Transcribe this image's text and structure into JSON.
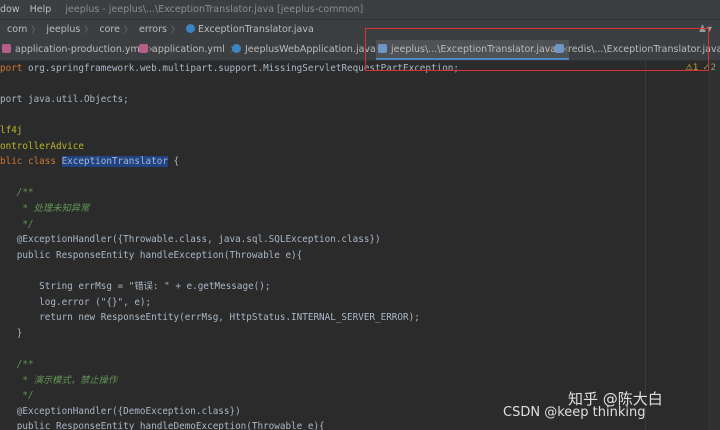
{
  "window": {
    "menu": [
      "dow",
      "Help"
    ],
    "title": "jeeplus - jeeplus\\...\\ExceptionTranslator.java [jeeplus-common]"
  },
  "breadcrumb": [
    "com",
    "jeeplus",
    "core",
    "errors",
    "ExceptionTranslator.java"
  ],
  "tabs": [
    {
      "label": "application-production.yml",
      "icon": "yml-file-icon"
    },
    {
      "label": "application.yml",
      "icon": "yml-file-icon"
    },
    {
      "label": "JeeplusWebApplication.java",
      "icon": "java-class-icon"
    },
    {
      "label": "jeeplus\\...\\ExceptionTranslator.java",
      "icon": "java-folder-icon"
    },
    {
      "label": "redis\\...\\ExceptionTranslator.java",
      "icon": "java-folder-icon"
    }
  ],
  "inspection": {
    "warnings": "1",
    "ok_count": "2"
  },
  "code": [
    "port org.springframework.web.multipart.support.MissingServletRequestPartException;",
    "",
    "port java.util.Objects;",
    "",
    "lf4j",
    "ontrollerAdvice",
    "blic class ExceptionTranslator {",
    "",
    "   /**",
    "    * 处理未知异常",
    "    */",
    "   @ExceptionHandler({Throwable.class, java.sql.SQLException.class})",
    "   public ResponseEntity handleException(Throwable e){",
    "",
    "       String errMsg = \"错误: \" + e.getMessage();",
    "       log.error (\"{}\", e);",
    "       return new ResponseEntity(errMsg, HttpStatus.INTERNAL_SERVER_ERROR);",
    "   }",
    "",
    "   /**",
    "    * 演示模式，禁止操作",
    "    */",
    "   @ExceptionHandler({DemoException.class})",
    "   public ResponseEntity handleDemoException(Throwable e){"
  ],
  "watermark": {
    "zhihu": "知乎 @陈大白",
    "csdn": "CSDN @keep   thinking"
  }
}
